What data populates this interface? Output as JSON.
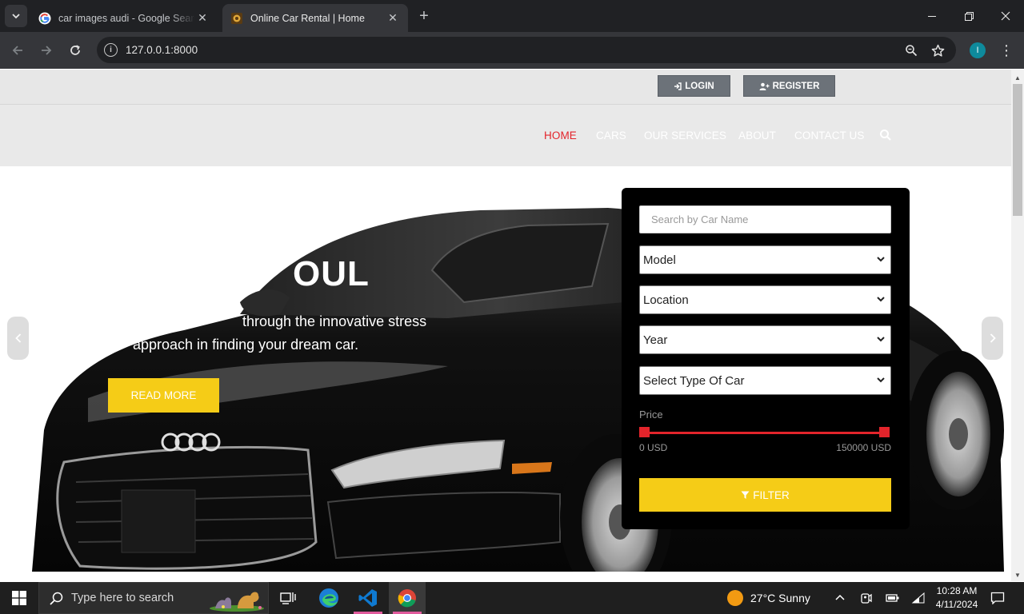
{
  "browser": {
    "tabs": [
      {
        "title": "car images audi - Google Search",
        "active": false
      },
      {
        "title": "Online Car Rental | Home",
        "active": true
      }
    ],
    "url": "127.0.0.1:8000",
    "profile_initial": "I"
  },
  "topbar": {
    "login_label": "LOGIN",
    "register_label": "REGISTER"
  },
  "nav": {
    "items": [
      {
        "label": "HOME",
        "active": true
      },
      {
        "label": "CARS",
        "active": false
      },
      {
        "label": "OUR SERVICES",
        "active": false
      },
      {
        "label": "ABOUT",
        "active": false
      },
      {
        "label": "CONTACT US",
        "active": false
      }
    ]
  },
  "hero": {
    "heading": "OUL",
    "line1": "through the innovative stress",
    "line2": "approach in finding your dream car.",
    "read_more": "READ MORE"
  },
  "filter": {
    "search_placeholder": "Search by Car Name",
    "selects": [
      "Model",
      "Location",
      "Year",
      "Select Type Of Car"
    ],
    "price_label": "Price",
    "price_min": "0 USD",
    "price_max": "150000 USD",
    "button_label": "FILTER"
  },
  "taskbar": {
    "search_placeholder": "Type here to search",
    "weather": "27°C  Sunny",
    "time": "10:28 AM",
    "date": "4/11/2024"
  },
  "colors": {
    "accent_red": "#e3242b",
    "accent_yellow": "#f5cc17"
  }
}
